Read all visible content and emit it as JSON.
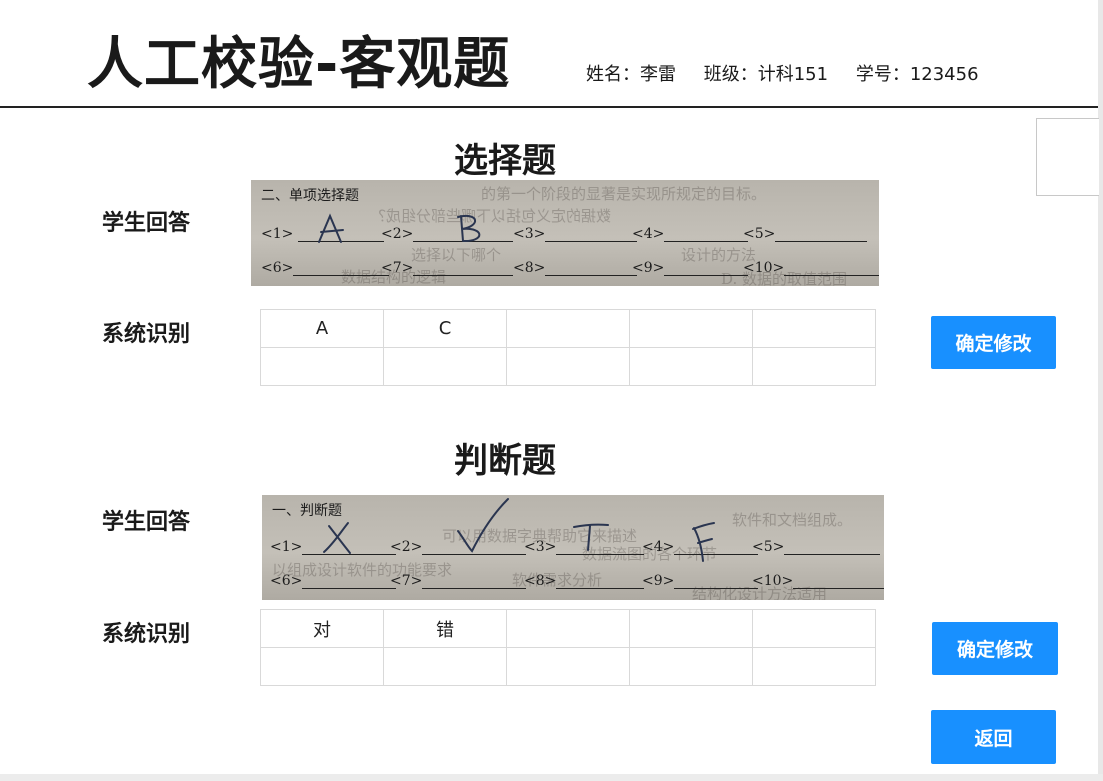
{
  "header": {
    "title": "人工校验-客观题",
    "student": {
      "name": "姓名：李雷",
      "class": "班级：计科151",
      "id": "学号：123456"
    }
  },
  "choice": {
    "heading": "选择题",
    "answer_label": "学生回答",
    "recognition_label": "系统识别",
    "scan": {
      "title": "二、单项选择题",
      "numbers_row1": [
        "<1>",
        "<2>",
        "<3>",
        "<4>",
        "<5>"
      ],
      "numbers_row2": [
        "<6>",
        "<7>",
        "<8>",
        "<9>",
        "<10>"
      ],
      "handwriting": [
        "A",
        "B"
      ],
      "bleed_text": [
        "的第一个阶段的显著是实现所规定的目标。",
        "数据的定义包括以下哪些部分组成？",
        "设计的方法",
        "数据结构的逻辑",
        "选择以下哪个",
        "D. 数据的取值范围"
      ]
    },
    "recognized": [
      [
        "A",
        "C",
        "",
        "",
        ""
      ],
      [
        "",
        "",
        "",
        "",
        ""
      ]
    ],
    "confirm_label": "确定修改"
  },
  "judge": {
    "heading": "判断题",
    "answer_label": "学生回答",
    "recognition_label": "系统识别",
    "scan": {
      "title": "一、判断题",
      "numbers_row1": [
        "<1>",
        "<2>",
        "<3>",
        "<4>",
        "<5>"
      ],
      "numbers_row2": [
        "<6>",
        "<7>",
        "<8>",
        "<9>",
        "<10>"
      ],
      "handwriting": [
        "✗",
        "✓",
        "T",
        "F"
      ],
      "bleed_text": [
        "软件和文档组成。",
        "可以用数据字典帮助它来描述",
        "数据流图的各个环节",
        "以组成设计软件的功能要求",
        "软件需求分析",
        "结构化设计方法适用"
      ]
    },
    "recognized": [
      [
        "对",
        "错",
        "",
        "",
        ""
      ],
      [
        "",
        "",
        "",
        "",
        ""
      ]
    ],
    "confirm_label": "确定修改"
  },
  "back_label": "返回"
}
